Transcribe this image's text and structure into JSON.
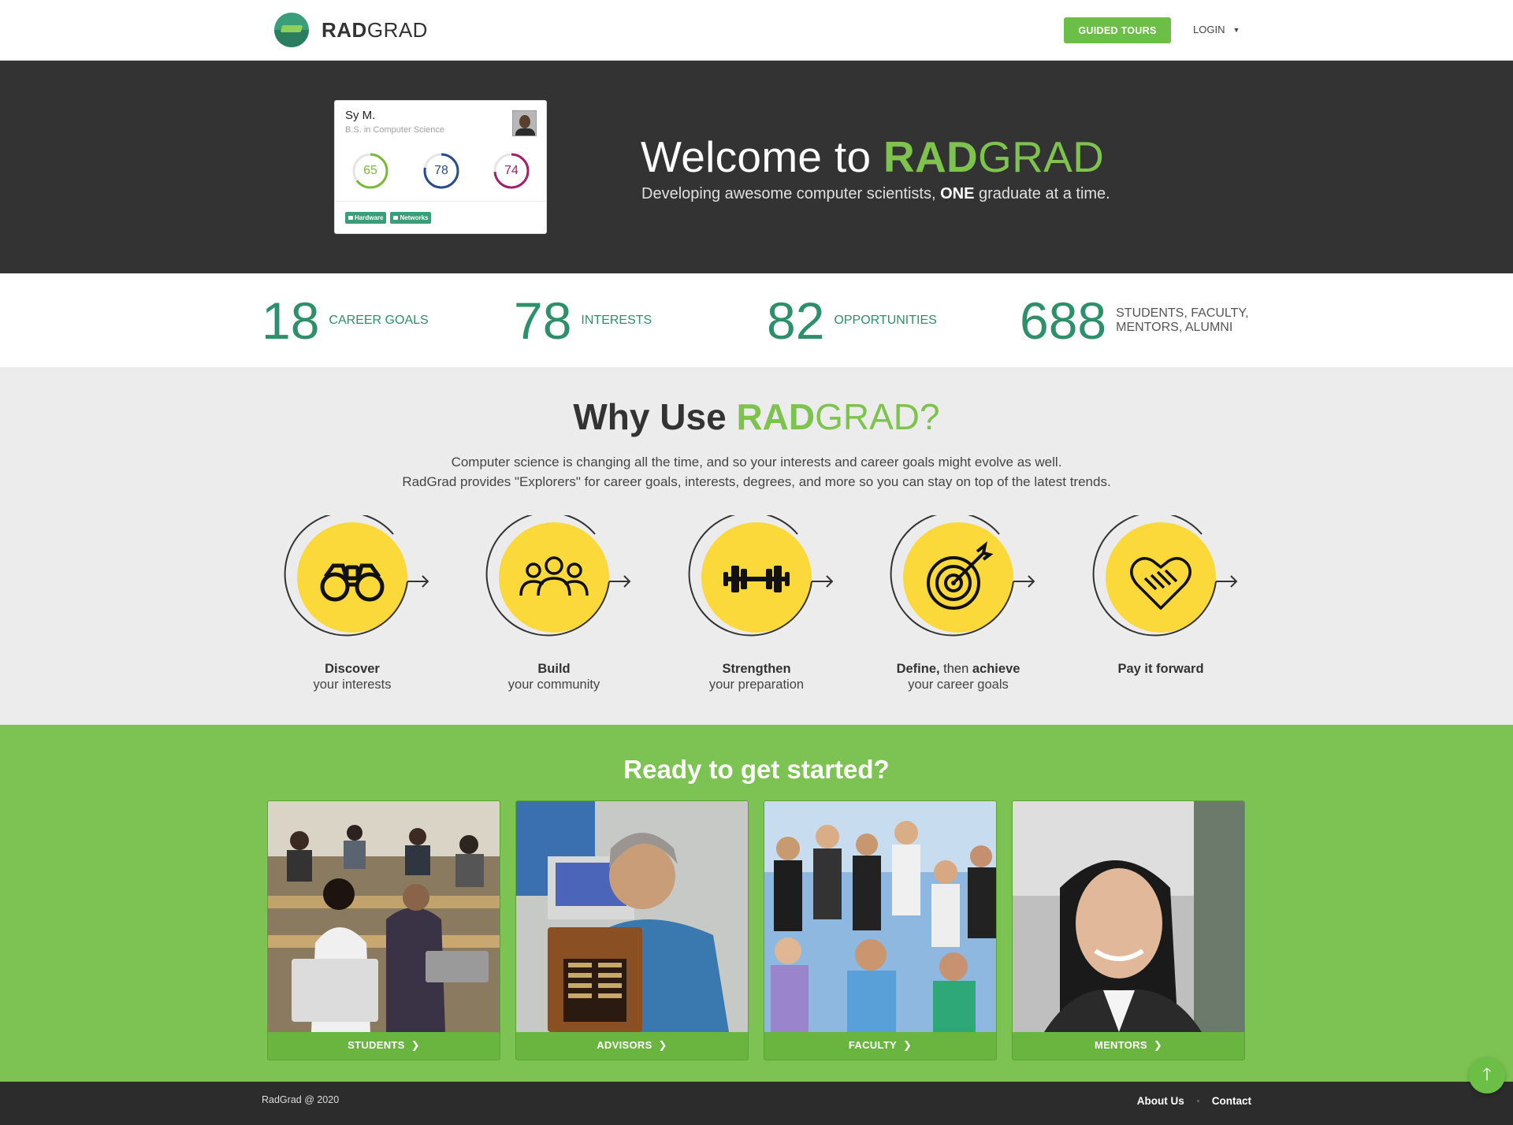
{
  "nav": {
    "logo_rad": "RAD",
    "logo_grad": "GRAD",
    "logo_icon": "mortarboard-logo",
    "guided_tours": "GUIDED TOURS",
    "login": "LOGIN"
  },
  "hero": {
    "card": {
      "name": "Sy M.",
      "degree": "B.S. in Computer Science",
      "scores": [
        {
          "value": "65",
          "level": 0.65,
          "color": "#7ab939"
        },
        {
          "value": "78",
          "level": 0.78,
          "color": "#2a4c88"
        },
        {
          "value": "74",
          "level": 0.74,
          "color": "#a3206a"
        }
      ],
      "tags": [
        "Hardware",
        "Networks"
      ]
    },
    "welcome": "Welcome to ",
    "brand_rad": "RAD",
    "brand_grad": "GRAD",
    "tagline_pre": "Developing awesome computer scientists, ",
    "tagline_bold": "ONE",
    "tagline_post": " graduate at a time."
  },
  "stats": [
    {
      "number": "18",
      "label_1": "CAREER GOALS",
      "label_2": ""
    },
    {
      "number": "78",
      "label_1": "INTERESTS",
      "label_2": ""
    },
    {
      "number": "82",
      "label_1": "OPPORTUNITIES",
      "label_2": ""
    },
    {
      "number": "688",
      "label_1": "STUDENTS, FACULTY,",
      "label_2": "MENTORS, ALUMNI"
    }
  ],
  "why": {
    "title_pre": "Why Use ",
    "title_rad": "RAD",
    "title_grad": "GRAD?",
    "desc_1": "Computer science is changing all the time, and so your interests and career goals might evolve as well.",
    "desc_2": "RadGrad provides \"Explorers\" for career goals, interests, degrees, and more so you can stay on top of the latest trends.",
    "features": [
      {
        "icon": "binoculars-icon",
        "title": "Discover",
        "title_light": "",
        "title_2": "",
        "subtitle": "your interests"
      },
      {
        "icon": "community-icon",
        "title": "Build",
        "title_light": "",
        "title_2": "",
        "subtitle": "your community"
      },
      {
        "icon": "dumbbell-icon",
        "title": "Strengthen",
        "title_light": "",
        "title_2": "",
        "subtitle": "your preparation"
      },
      {
        "icon": "target-icon",
        "title": "Define,",
        "title_light": " then ",
        "title_2": "achieve",
        "subtitle": "your career goals"
      },
      {
        "icon": "handshake-heart-icon",
        "title": "Pay it forward",
        "title_light": "",
        "title_2": "",
        "subtitle": ""
      }
    ],
    "accent": "#fbd93b"
  },
  "started": {
    "title": "Ready to get started?",
    "cards": [
      {
        "label": "STUDENTS"
      },
      {
        "label": "ADVISORS"
      },
      {
        "label": "FACULTY"
      },
      {
        "label": "MENTORS"
      }
    ]
  },
  "footer": {
    "copyright": "RadGrad @ 2020",
    "about": "About Us",
    "contact": "Contact"
  },
  "colors": {
    "brand_green": "#7fc34f",
    "teal": "#2e8f6b",
    "hero_bg": "#333333"
  }
}
